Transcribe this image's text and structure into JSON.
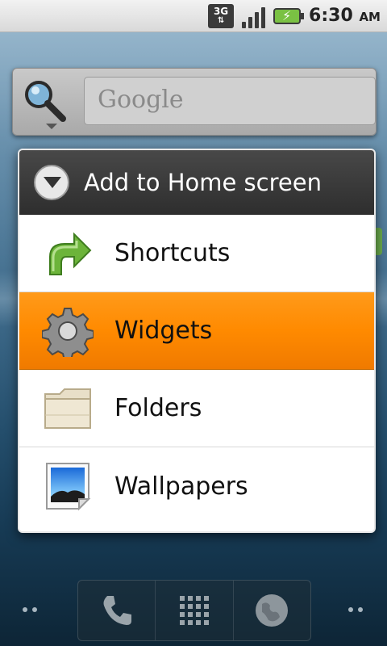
{
  "status_bar": {
    "network": "3G",
    "network_arrows": "⇅",
    "signal_bars": 4,
    "battery_level_percent": 75,
    "time": "6:30",
    "ampm": "AM"
  },
  "search": {
    "placeholder": "Google"
  },
  "dialog": {
    "title": "Add to Home screen",
    "items": [
      {
        "label": "Shortcuts",
        "icon": "shortcut-arrow-icon",
        "selected": false
      },
      {
        "label": "Widgets",
        "icon": "gear-icon",
        "selected": true
      },
      {
        "label": "Folders",
        "icon": "folder-icon",
        "selected": false
      },
      {
        "label": "Wallpapers",
        "icon": "wallpaper-icon",
        "selected": false
      }
    ]
  },
  "dock": {
    "buttons": [
      "phone-icon",
      "app-drawer-icon",
      "browser-globe-icon"
    ]
  },
  "colors": {
    "selected_item": "#ff8a00",
    "header_bg": "#3a3a3a",
    "shortcut_green": "#5aa632"
  }
}
